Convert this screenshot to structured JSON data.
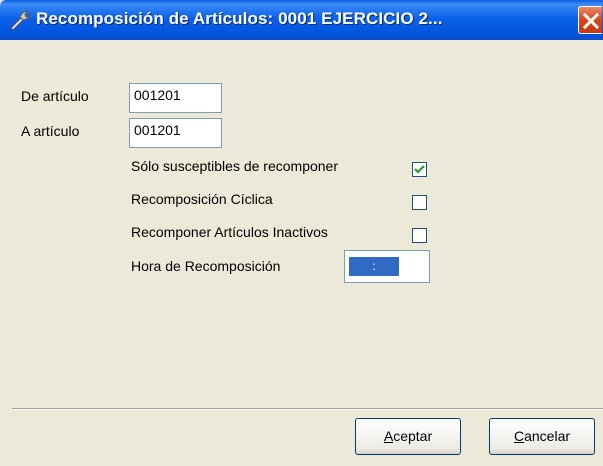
{
  "window": {
    "title": "Recomposición de Artículos: 0001 EJERCICIO 2...",
    "title_icon": "wrench-tool-icon",
    "close_icon": "close-icon"
  },
  "form": {
    "from_article_label": "De artículo",
    "from_article_value": "001201",
    "to_article_label": "A artículo",
    "to_article_value": "001201",
    "only_recomposable_label": "Sólo susceptibles de recomponer",
    "only_recomposable_checked": true,
    "cyclic_label": "Recomposición Cíclica",
    "cyclic_checked": false,
    "inactive_label": "Recomponer Artículos Inactivos",
    "inactive_checked": false,
    "time_label": "Hora de Recomposición",
    "time_value": ":"
  },
  "buttons": {
    "accept_mnemonic": "A",
    "accept_rest": "ceptar",
    "cancel_mnemonic": "C",
    "cancel_rest": "ancelar"
  },
  "colors": {
    "titlebar": "#0254DC",
    "close_button": "#D7461C",
    "dialog_background": "#ECE9D8",
    "selection": "#316AC5"
  }
}
